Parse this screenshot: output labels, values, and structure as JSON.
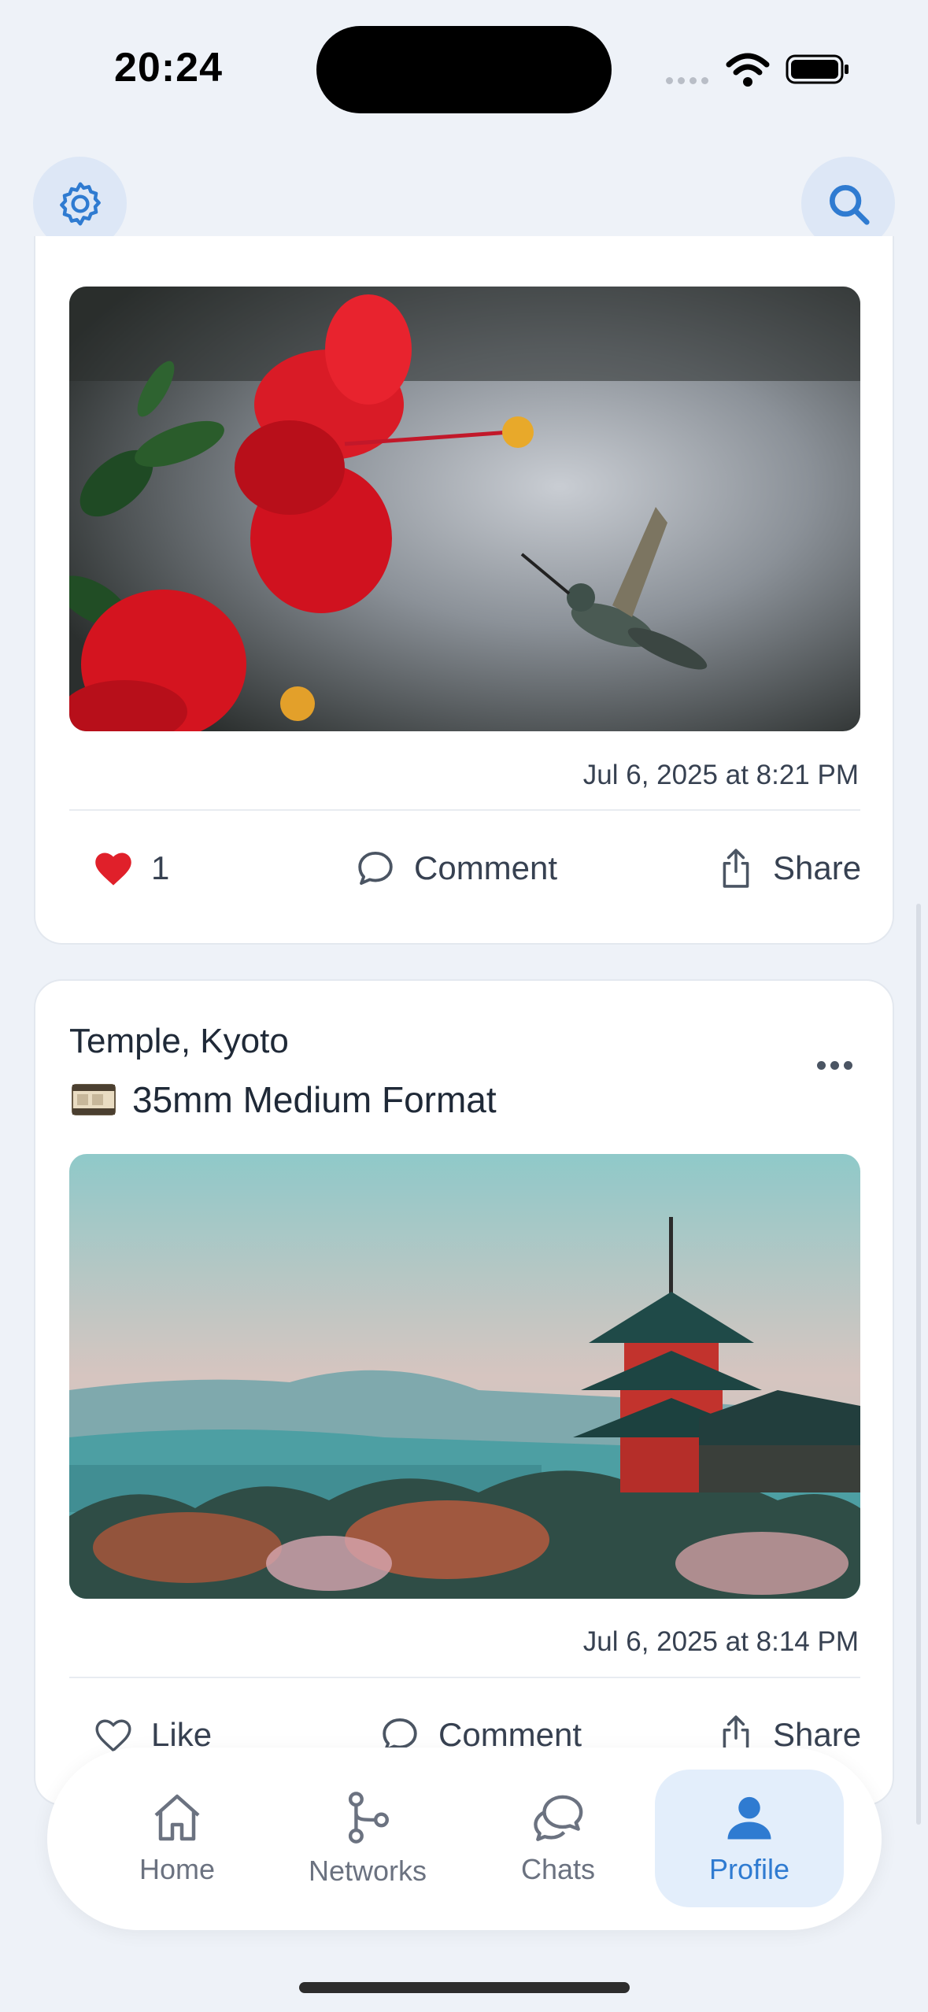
{
  "status_bar": {
    "time": "20:24"
  },
  "top_bar": {
    "settings_icon": "gear-icon",
    "search_icon": "search-icon"
  },
  "posts": [
    {
      "image": "hummingbird-hibiscus-photo",
      "timestamp": "Jul 6, 2025 at 8:21 PM",
      "like_count": "1",
      "comment_label": "Comment",
      "share_label": "Share"
    },
    {
      "title": "Temple, Kyoto",
      "camera": "35mm Medium Format",
      "image": "kyoto-pagoda-photo",
      "timestamp": "Jul 6, 2025 at 8:14 PM",
      "like_label": "Like",
      "comment_label": "Comment",
      "share_label": "Share"
    }
  ],
  "tabbar": {
    "tabs": [
      {
        "label": "Home",
        "icon": "home-icon"
      },
      {
        "label": "Networks",
        "icon": "network-icon"
      },
      {
        "label": "Chats",
        "icon": "chat-icon"
      },
      {
        "label": "Profile",
        "icon": "profile-icon",
        "active": true
      }
    ]
  },
  "colors": {
    "accent": "#2f7bd1",
    "like_red": "#e0202a",
    "background": "#eef2f8"
  }
}
